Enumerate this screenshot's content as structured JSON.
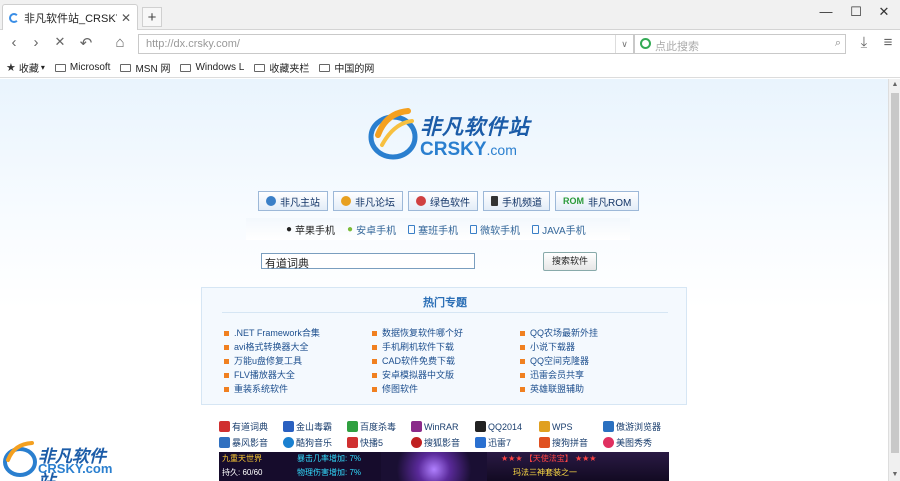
{
  "tab": {
    "title": "非凡软件站_CRSKY.com...",
    "close": "✕",
    "new_tab": "+"
  },
  "window": {
    "minimize": "—",
    "maximize": "☐",
    "close": "✕"
  },
  "nav": {
    "back": "‹",
    "forward": "›",
    "stop": "✕",
    "undo": "↶",
    "home": "⌂",
    "download": "⤓",
    "menu": "≡"
  },
  "address": {
    "url": "http://dx.crsky.com/",
    "dropdown": "∨"
  },
  "search": {
    "placeholder": "点此搜索",
    "icon": "⌕"
  },
  "favorites": {
    "star_label": "收藏",
    "items": [
      "Microsoft",
      "MSN 网",
      "Windows L",
      "收藏夹栏",
      "中国的网"
    ]
  },
  "logo": {
    "cn": "非凡软件站",
    "en_main": "CRSKY",
    "en_suffix": ".com"
  },
  "main_nav": [
    {
      "label": "非凡主站",
      "color": "#3a7fc7"
    },
    {
      "label": "非凡论坛",
      "color": "#e8a020"
    },
    {
      "label": "绿色软件",
      "color": "#d04040"
    },
    {
      "label": "手机频道",
      "color": "#333333"
    },
    {
      "label": "非凡ROM",
      "prefix": "ROM",
      "color": "#2a9a3a"
    }
  ],
  "phones": [
    "苹果手机",
    "安卓手机",
    "塞班手机",
    "微软手机",
    "JAVA手机"
  ],
  "search_form": {
    "value": "有道词典",
    "button": "搜索软件"
  },
  "hot": {
    "title": "热门专题",
    "col1": [
      ".NET Framework合集",
      "avi格式转换器大全",
      "万能u盘修复工具",
      "FLV播放器大全",
      "重装系统软件"
    ],
    "col2": [
      "数据恢复软件哪个好",
      "手机刷机软件下载",
      "CAD软件免费下载",
      "安卓模拟器中文版",
      "修图软件"
    ],
    "col3": [
      "QQ农场最新外挂",
      "小说下载器",
      "QQ空间克隆器",
      "迅雷会员共享",
      "英雄联盟辅助"
    ]
  },
  "apps": {
    "row1": [
      {
        "label": "有道词典",
        "color": "#d03030"
      },
      {
        "label": "金山毒霸",
        "color": "#2a60c0"
      },
      {
        "label": "百度杀毒",
        "color": "#30a040"
      },
      {
        "label": "WinRAR",
        "color": "#8a2a8a"
      },
      {
        "label": "QQ2014",
        "color": "#222222"
      },
      {
        "label": "WPS",
        "color": "#e0a020"
      },
      {
        "label": "傲游浏览器",
        "color": "#2a70c0"
      }
    ],
    "row2": [
      {
        "label": "暴风影音",
        "color": "#3070c0"
      },
      {
        "label": "酷狗音乐",
        "color": "#1a80d0"
      },
      {
        "label": "快播5",
        "color": "#d03030"
      },
      {
        "label": "搜狐影音",
        "color": "#c02020"
      },
      {
        "label": "迅雷7",
        "color": "#2a70d0"
      },
      {
        "label": "搜狗拼音",
        "color": "#e05020"
      },
      {
        "label": "美图秀秀",
        "color": "#e03060"
      }
    ]
  },
  "banner": {
    "left1": "九重天世界",
    "left2": "持久: 60/60",
    "mid1": "暴击几率增加: 7%",
    "mid2": "物理伤害增加: 7%",
    "right1": "★★★ 【天使法宝】 ★★★",
    "right2": "玛法三神套装之一"
  },
  "watermark": {
    "cn": "非凡软件站",
    "en": "CRSKY.com"
  }
}
